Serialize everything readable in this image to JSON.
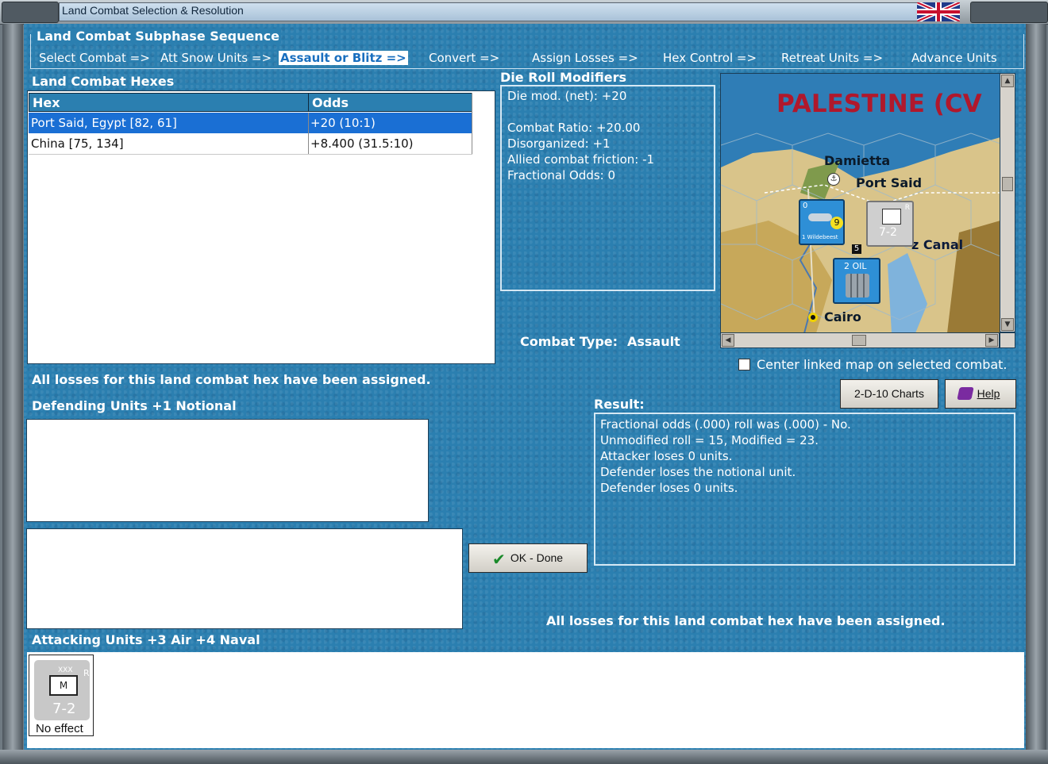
{
  "window": {
    "title": "Land Combat Selection & Resolution"
  },
  "sequence": {
    "legend": "Land Combat Subphase Sequence",
    "steps": [
      "Select Combat =>",
      "Att Snow Units =>",
      "Assault or Blitz =>",
      "Convert =>",
      "Assign Losses =>",
      "Hex Control =>",
      "Retreat Units =>",
      "Advance Units"
    ],
    "active_index": 2
  },
  "hexes": {
    "title": "Land Combat Hexes",
    "columns": [
      "Hex",
      "Odds"
    ],
    "rows": [
      {
        "hex": "Port Said, Egypt [82, 61]",
        "odds": "+20 (10:1)"
      },
      {
        "hex": "China [75, 134]",
        "odds": "+8.400 (31.5:10)"
      }
    ],
    "selected_index": 0
  },
  "die_roll": {
    "title": "Die Roll Modifiers",
    "lines": [
      "Die mod. (net): +20",
      "",
      "Combat Ratio: +20.00",
      "Disorganized: +1",
      "Allied combat friction: -1",
      "Fractional Odds: 0"
    ]
  },
  "combat_type": {
    "label": "Combat Type:",
    "value": "Assault"
  },
  "map": {
    "title": "PALESTINE (CV",
    "labels": [
      "Damietta",
      "Port Said",
      "z Canal",
      "Cairo"
    ],
    "unit_counters": [
      {
        "top": "0",
        "value": "9",
        "name": "1 Wildebeest"
      },
      {
        "value": "7-2",
        "side": "R"
      },
      {
        "value": "2 OIL"
      }
    ],
    "hex_number": "5"
  },
  "center_map": {
    "label": "Center linked map on selected combat.",
    "checked": false
  },
  "buttons": {
    "charts": "2-D-10 Charts",
    "help": "Help",
    "ok": "OK - Done"
  },
  "losses_msg_left": "All losses for this land combat hex have been assigned.",
  "losses_msg_right": "All losses for this land combat hex have been assigned.",
  "defending": {
    "title": "Defending Units +1 Notional"
  },
  "result": {
    "title": "Result:",
    "lines": [
      "Fractional odds (.000) roll was (.000)  - No.",
      "Unmodified roll = 15, Modified = 23.",
      "Attacker loses 0 units.",
      "Defender loses the notional unit.",
      "Defender loses 0 units."
    ]
  },
  "attacking": {
    "title": "Attacking Units +3 Air +4 Naval",
    "units": [
      {
        "size": "XXX",
        "type": "M",
        "value": "7-2",
        "side": "R",
        "caption": "No effect"
      }
    ]
  },
  "colors": {
    "panel": "#2b7fb0",
    "selection": "#1a6fd4",
    "map_title": "#b0182c"
  }
}
